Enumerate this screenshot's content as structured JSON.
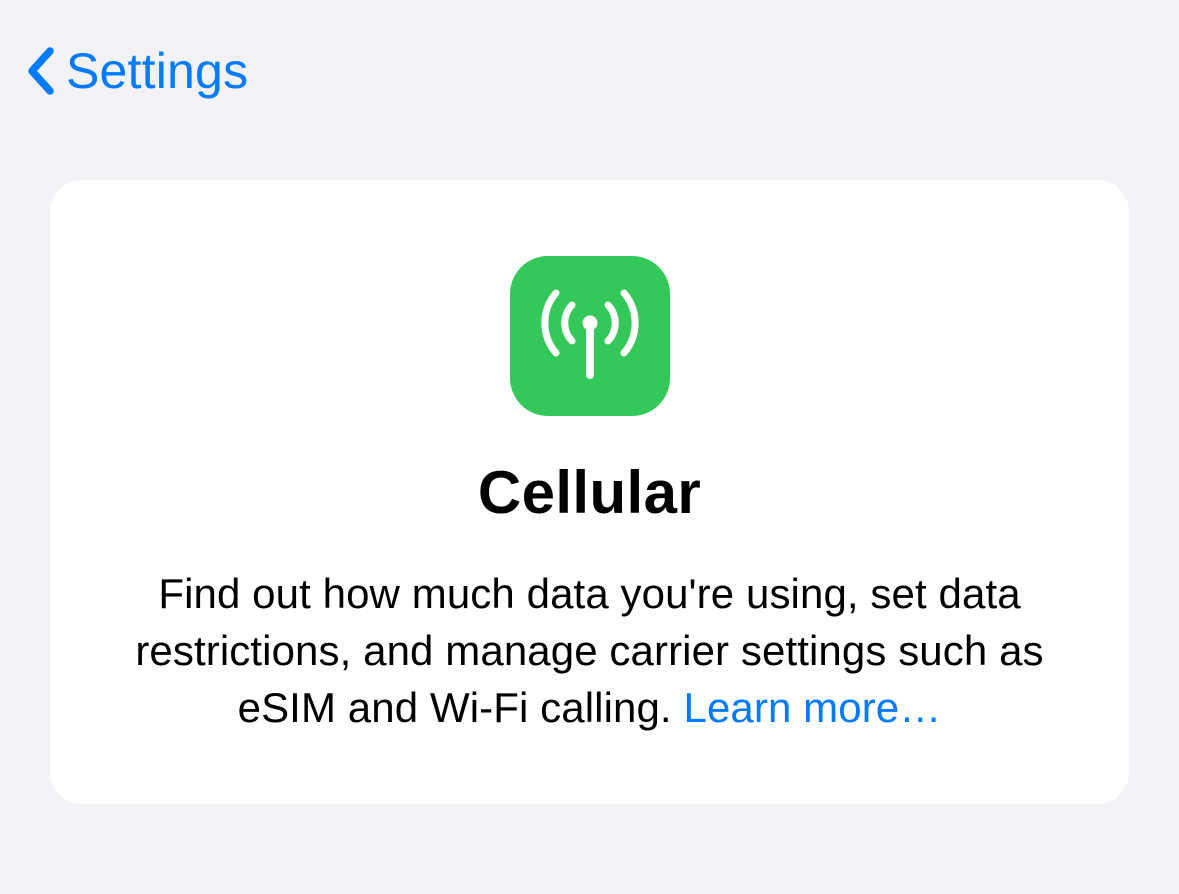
{
  "colors": {
    "accent": "#007aff",
    "icon_bg": "#34c759",
    "page_bg": "#f2f2f7",
    "card_bg": "#ffffff"
  },
  "nav": {
    "back_label": "Settings"
  },
  "card": {
    "icon_name": "antenna-icon",
    "title": "Cellular",
    "description": "Find out how much data you're using, set data restrictions, and manage carrier settings such as eSIM and Wi-Fi calling. ",
    "learn_more_label": "Learn more…"
  }
}
